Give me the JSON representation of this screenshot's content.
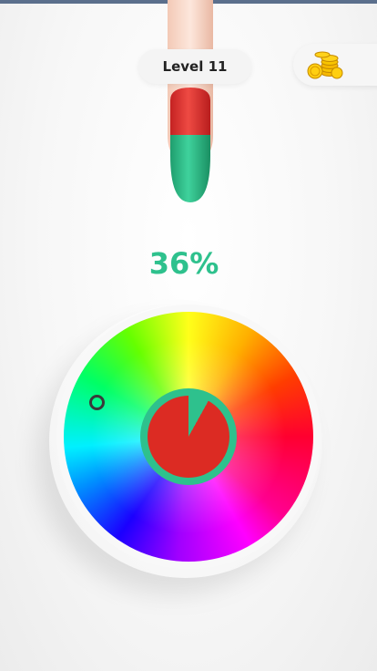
{
  "header": {
    "level_label": "Level 11"
  },
  "hud": {
    "coins_icon": "gold-coins-stack-icon"
  },
  "progress": {
    "percent_text": "36%",
    "percent_value": 36,
    "color": "#2ec18d"
  },
  "nail": {
    "target_color": "#dc2b23",
    "base_color": "#2ec18d",
    "painted_fraction": 0.36
  },
  "color_wheel": {
    "ring_color": "#2ec18d",
    "target_color": "#dc2b23",
    "match_fraction": 0.92
  }
}
